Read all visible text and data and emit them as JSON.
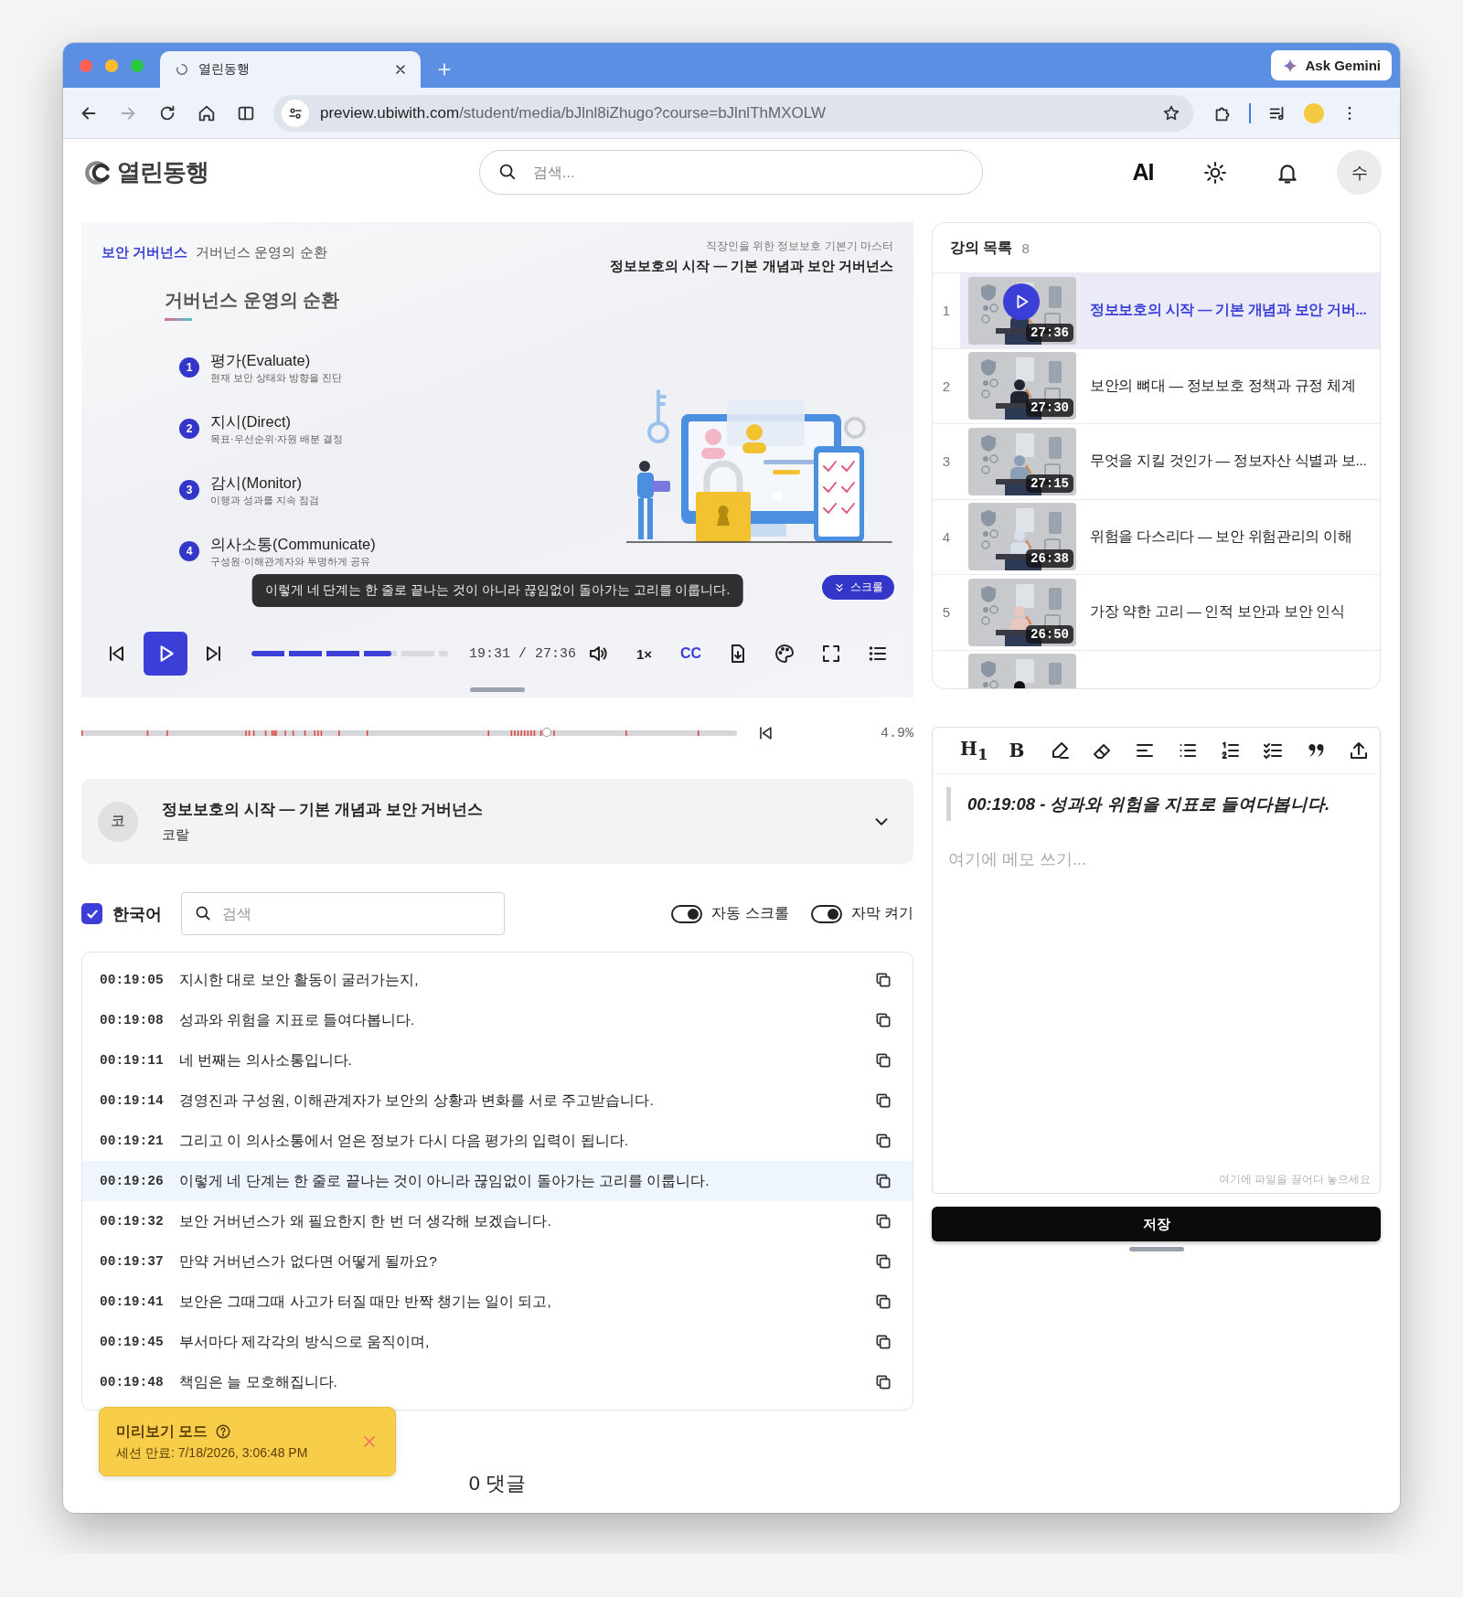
{
  "browser": {
    "tab": {
      "title": "열린동행"
    },
    "ask_button": "Ask Gemini",
    "forward": {
      "disabled": true
    },
    "url": {
      "host": "preview.ubiwith.com",
      "path": "/student/media/bJlnl8iZhugo?course=bJlnlThMXOLW"
    }
  },
  "header": {
    "logo": "열린동행",
    "search": {
      "placeholder": "검색..."
    },
    "ai_label": "AI",
    "avatar": "수"
  },
  "video": {
    "breadcrumb": {
      "section": "보안 거버넌스",
      "page": "거버넌스 운영의 순환"
    },
    "course_name": "직장인을 위한 정보보호 기본기 마스터",
    "lecture_title": "정보보호의 시작 — 기본 개념과 보안 거버넌스",
    "slide_title": "거버넌스 운영의 순환",
    "steps": [
      {
        "number": "1",
        "title": "평가(Evaluate)",
        "desc": "현재 보안 상태와 방향을 진단"
      },
      {
        "number": "2",
        "title": "지시(Direct)",
        "desc": "목표·우선순위·자원 배분 결정"
      },
      {
        "number": "3",
        "title": "감시(Monitor)",
        "desc": "이행과 성과를 지속 점검"
      },
      {
        "number": "4",
        "title": "의사소통(Communicate)",
        "desc": "구성원·이해관계자와 투명하게 공유"
      }
    ],
    "caption": "이렇게 네 단계는 한 줄로 끝나는 것이 아니라 끊임없이 돌아가는 고리를 이룹니다.",
    "scroll_button": "스크롤"
  },
  "player": {
    "progress": {
      "level": 0.71
    },
    "time": "19:31 / 27:36",
    "speed": "1×",
    "cc": {
      "label": "CC",
      "on": true
    }
  },
  "timeline": {
    "level": 0.71,
    "percent": "4.9%"
  },
  "course_card": {
    "avatar": "코",
    "title": "정보보호의 시작 — 기본 개념과 보안 거버넌스",
    "author": "코랄",
    "expanded": false
  },
  "transcript": {
    "language": {
      "label": "한국어",
      "checked": true
    },
    "search": {
      "placeholder": "검색"
    },
    "toggles": [
      {
        "label": "자동 스크롤",
        "on": true
      },
      {
        "label": "자막 켜기",
        "on": true
      }
    ],
    "rows": [
      {
        "time": "00:19:05",
        "text": "지시한 대로 보안 활동이 굴러가는지,",
        "selected": false
      },
      {
        "time": "00:19:08",
        "text": "성과와 위험을 지표로 들여다봅니다.",
        "selected": false
      },
      {
        "time": "00:19:11",
        "text": "네 번째는 의사소통입니다.",
        "selected": false
      },
      {
        "time": "00:19:14",
        "text": "경영진과 구성원, 이해관계자가 보안의 상황과 변화를 서로 주고받습니다.",
        "selected": false
      },
      {
        "time": "00:19:21",
        "text": "그리고 이 의사소통에서 얻은 정보가 다시 다음 평가의 입력이 됩니다.",
        "selected": false
      },
      {
        "time": "00:19:26",
        "text": "이렇게 네 단계는 한 줄로 끝나는 것이 아니라 끊임없이 돌아가는 고리를 이룹니다.",
        "selected": true
      },
      {
        "time": "00:19:32",
        "text": "보안 거버넌스가 왜 필요한지 한 번 더 생각해 보겠습니다.",
        "selected": false
      },
      {
        "time": "00:19:37",
        "text": "만약 거버넌스가 없다면 어떻게 될까요?",
        "selected": false
      },
      {
        "time": "00:19:41",
        "text": "보안은 그때그때 사고가 터질 때만 반짝 챙기는 일이 되고,",
        "selected": false
      },
      {
        "time": "00:19:45",
        "text": "부서마다 제각각의 방식으로 움직이며,",
        "selected": false
      },
      {
        "time": "00:19:48",
        "text": "책임은 늘 모호해집니다.",
        "selected": false
      }
    ]
  },
  "toast": {
    "title": "미리보기 모드",
    "expiry": "세션 만료: 7/18/2026, 3:06:48 PM"
  },
  "comments": "0 댓글",
  "playlist": {
    "title": "강의 목록",
    "count": "8",
    "items": [
      {
        "number": "1",
        "title": "정보보호의 시작 — 기본 개념과 보안 거버...",
        "duration": "27:36",
        "selected": true
      },
      {
        "number": "2",
        "title": "보안의 뼈대 — 정보보호 정책과 규정 체계",
        "duration": "27:30",
        "selected": false
      },
      {
        "number": "3",
        "title": "무엇을 지킬 것인가 — 정보자산 식별과 보...",
        "duration": "27:15",
        "selected": false
      },
      {
        "number": "4",
        "title": "위험을 다스리다 — 보안 위험관리의 이해",
        "duration": "26:38",
        "selected": false
      },
      {
        "number": "5",
        "title": "가장 약한 고리 — 인적 보안과 보안 인식",
        "duration": "26:50",
        "selected": false
      },
      {
        "selected": false
      }
    ]
  },
  "editor": {
    "toolbar": [
      {
        "kind": "text",
        "label": "H$_{1}$"
      },
      {
        "kind": "text",
        "label": "B"
      },
      {
        "kind": "highlight"
      },
      {
        "kind": "eraser"
      },
      {
        "kind": "align"
      },
      {
        "kind": "bullets"
      },
      {
        "kind": "numbers"
      },
      {
        "kind": "checklist"
      },
      {
        "kind": "quote"
      },
      {
        "kind": "upload"
      }
    ],
    "quote": "00:19:08 - 성과와 위험을 지표로 들여다봅니다.",
    "placeholder": "여기에 메모 쓰기...",
    "drop_hint": "여기에 파일을 끌어다 놓으세요",
    "save_button": "저장"
  }
}
